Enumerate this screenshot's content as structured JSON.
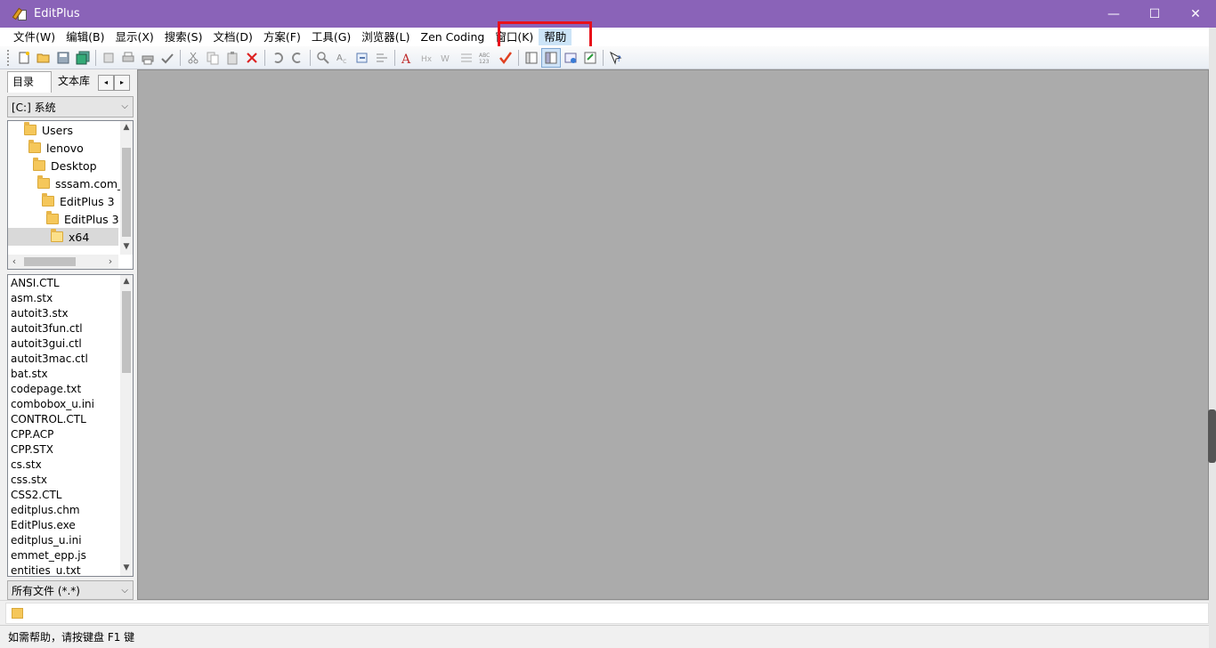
{
  "window": {
    "title": "EditPlus",
    "minimize_glyph": "—",
    "maximize_glyph": "☐",
    "close_glyph": "✕"
  },
  "menu": {
    "items": [
      {
        "label": "文件(W)"
      },
      {
        "label": "编辑(B)"
      },
      {
        "label": "显示(X)"
      },
      {
        "label": "搜索(S)"
      },
      {
        "label": "文档(D)"
      },
      {
        "label": "方案(F)"
      },
      {
        "label": "工具(G)"
      },
      {
        "label": "浏览器(L)"
      },
      {
        "label": "Zen Coding"
      },
      {
        "label": "窗口(K)"
      },
      {
        "label": "帮助"
      }
    ],
    "highlight_color": "#e8101a",
    "hover_item": "帮助"
  },
  "toolbar": {
    "icons": [
      "new-file-icon",
      "open-folder-icon",
      "save-icon",
      "save-all-icon",
      "reload-icon",
      "print-preview-icon",
      "print-icon",
      "spell-check-icon",
      "cut-icon",
      "copy-icon",
      "paste-icon",
      "delete-icon",
      "undo-icon",
      "redo-icon",
      "find-icon",
      "replace-icon",
      "goto-icon",
      "jump-icon",
      "font-icon",
      "hex-icon",
      "word-wrap-icon",
      "line-number-icon",
      "column-icon",
      "check-mark-icon",
      "view-directory-icon",
      "view-cliptext-icon",
      "browser-icon",
      "output-window-icon",
      "help-context-icon"
    ]
  },
  "sidebar": {
    "tab_directory": "目录",
    "tab_cliptext": "文本库",
    "tab_prev": "◂",
    "tab_next": "▸",
    "drive": "[C:] 系统",
    "tree": [
      {
        "label": "Users",
        "indent": 0
      },
      {
        "label": "lenovo",
        "indent": 1
      },
      {
        "label": "Desktop",
        "indent": 2
      },
      {
        "label": "sssam.com_",
        "indent": 3
      },
      {
        "label": "EditPlus 3",
        "indent": 4
      },
      {
        "label": "EditPlus 3",
        "indent": 5
      },
      {
        "label": "x64",
        "indent": 6,
        "selected": true
      }
    ],
    "files": [
      "ANSI.CTL",
      "asm.stx",
      "autoit3.stx",
      "autoit3fun.ctl",
      "autoit3gui.ctl",
      "autoit3mac.ctl",
      "bat.stx",
      "codepage.txt",
      "combobox_u.ini",
      "CONTROL.CTL",
      "CPP.ACP",
      "CPP.STX",
      "cs.stx",
      "css.stx",
      "CSS2.CTL",
      "editplus.chm",
      "EditPlus.exe",
      "editplus_u.ini",
      "emmet_epp.js",
      "entities_u.txt"
    ],
    "filter": "所有文件 (*.*)"
  },
  "statusbar": {
    "help_text": "如需帮助，请按键盘 F1 键"
  }
}
